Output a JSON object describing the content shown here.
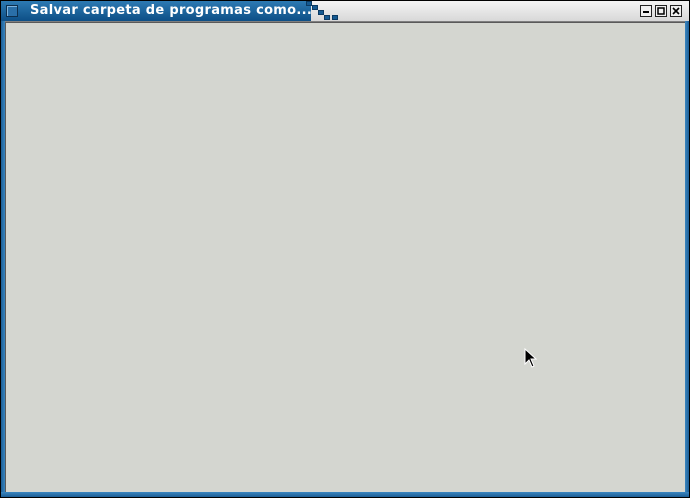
{
  "window": {
    "title": "Salvar carpeta de programas como...",
    "controls": {
      "minimize_icon": "minimize-icon",
      "maximize_icon": "maximize-icon",
      "close_icon": "close-icon"
    }
  },
  "colors": {
    "title_tab": "#1b649f",
    "content_background": "#d4d6d0",
    "frame_border": "#1c5e95"
  },
  "cursor": {
    "icon": "arrow-pointer-icon"
  }
}
